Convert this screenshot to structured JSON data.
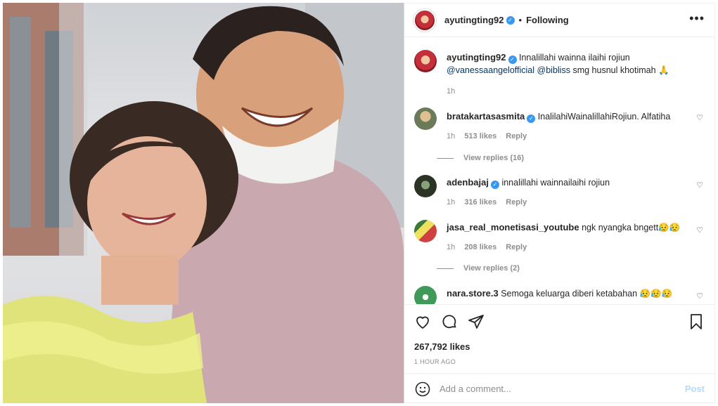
{
  "header": {
    "username": "ayutingting92",
    "separator": "•",
    "follow_status": "Following",
    "more_label": "•••"
  },
  "caption": {
    "username": "ayutingting92",
    "text": "Innalillahi wainna ilaihi rojiun",
    "mention1": "@vanessaangelofficial",
    "mention2": "@bibliss",
    "text_end": "smg husnul khotimah 🙏",
    "time": "1h"
  },
  "comments": [
    {
      "username": "bratakartasasmita",
      "verified": true,
      "text": "InalilahiWainalillahiRojiun. Alfatiha",
      "time": "1h",
      "likes": "513 likes",
      "reply": "Reply",
      "view_replies": "View replies (16)"
    },
    {
      "username": "adenbajaj",
      "verified": true,
      "text": "innalillahi wainnailaihi rojiun",
      "time": "1h",
      "likes": "316 likes",
      "reply": "Reply",
      "view_replies": ""
    },
    {
      "username": "jasa_real_monetisasi_youtube",
      "verified": false,
      "text": "ngk nyangka bngett😥😥",
      "time": "1h",
      "likes": "208 likes",
      "reply": "Reply",
      "view_replies": "View replies (2)"
    },
    {
      "username": "nara.store.3",
      "verified": false,
      "text": "Semoga keluarga diberi ketabahan 😥😥😥",
      "time": "",
      "likes": "",
      "reply": "",
      "view_replies": ""
    }
  ],
  "actions": {
    "likes": "267,792 likes",
    "time_ago": "1 HOUR AGO",
    "comment_placeholder": "Add a comment...",
    "post_label": "Post"
  },
  "icons": [
    "heart-icon",
    "comment-icon",
    "share-icon",
    "bookmark-icon",
    "emoji-icon",
    "verified-icon",
    "more-icon"
  ],
  "colors": {
    "link": "#00376b",
    "verified": "#3897f0",
    "post_disabled": "#b3dbff",
    "meta": "#8e8e8e"
  }
}
